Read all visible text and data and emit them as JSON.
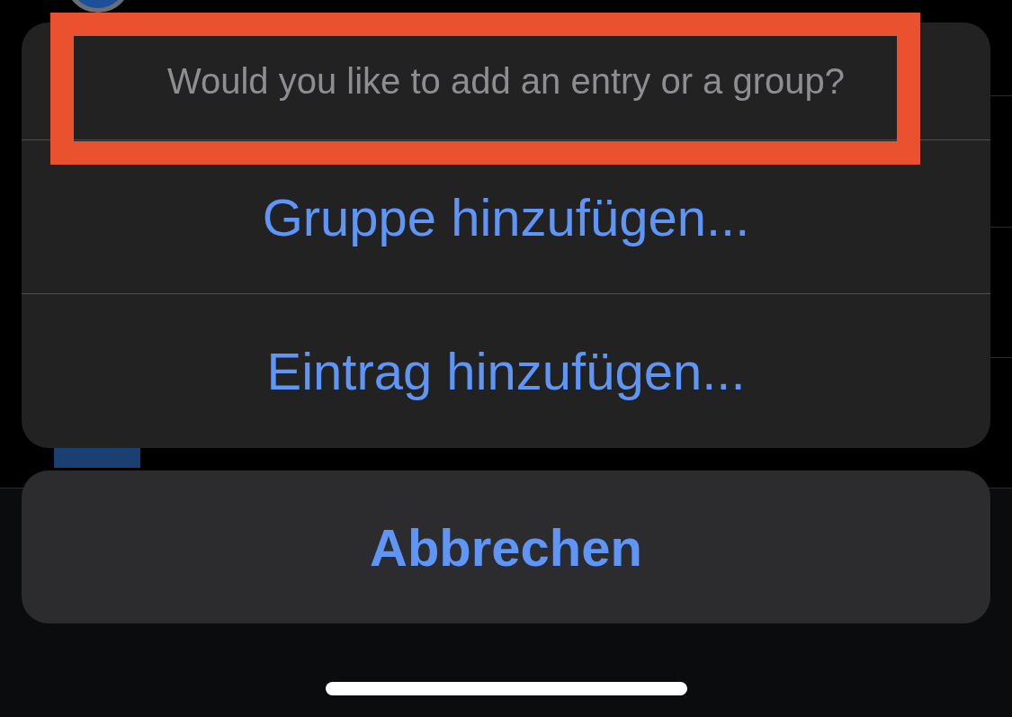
{
  "action_sheet": {
    "title": {
      "text": "Would you like to add an entry or a group?",
      "highlighted": true
    },
    "actions": [
      {
        "label": "Gruppe hinzufügen..."
      },
      {
        "label": "Eintrag hinzufügen..."
      }
    ],
    "cancel": {
      "label": "Abbrechen"
    }
  }
}
